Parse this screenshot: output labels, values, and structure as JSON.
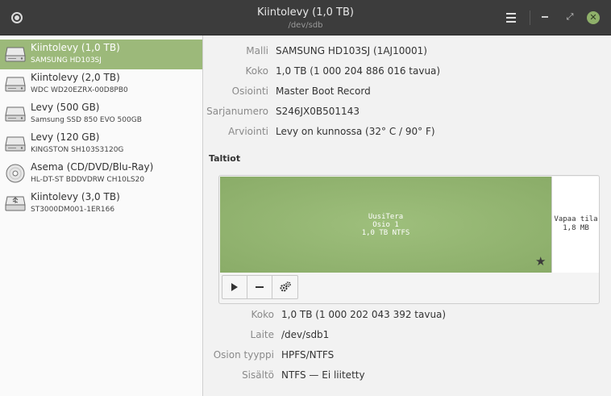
{
  "window": {
    "title": "Kiintolevy (1,0 TB)",
    "subtitle": "/dev/sdb"
  },
  "disks": [
    {
      "name": "Kiintolevy (1,0 TB)",
      "model": "SAMSUNG HD103SJ",
      "icon": "harddisk-icon",
      "selected": true
    },
    {
      "name": "Kiintolevy (2,0 TB)",
      "model": "WDC WD20EZRX-00D8PB0",
      "icon": "harddisk-icon",
      "selected": false
    },
    {
      "name": "Levy (500 GB)",
      "model": "Samsung SSD 850 EVO 500GB",
      "icon": "harddisk-icon",
      "selected": false
    },
    {
      "name": "Levy (120 GB)",
      "model": "KINGSTON SH103S3120G",
      "icon": "harddisk-icon",
      "selected": false
    },
    {
      "name": "Asema (CD/DVD/Blu-Ray)",
      "model": "HL-DT-ST BDDVDRW CH10LS20",
      "icon": "optical-disc-icon",
      "selected": false
    },
    {
      "name": "Kiintolevy (3,0 TB)",
      "model": "ST3000DM001-1ER166",
      "icon": "usb-drive-icon",
      "selected": false
    }
  ],
  "drive_props": [
    {
      "label": "Malli",
      "value": "SAMSUNG HD103SJ (1AJ10001)"
    },
    {
      "label": "Koko",
      "value": "1,0 TB (1 000 204 886 016 tavua)"
    },
    {
      "label": "Osiointi",
      "value": "Master Boot Record"
    },
    {
      "label": "Sarjanumero",
      "value": "S246JX0B501143"
    },
    {
      "label": "Arviointi",
      "value": "Levy on kunnossa (32° C / 90° F)"
    }
  ],
  "volumes": {
    "title": "Taltiot",
    "partition": {
      "name": "UusiTera",
      "number": "Osio 1",
      "desc": "1,0 TB NTFS"
    },
    "free": {
      "label": "Vapaa tila",
      "size": "1,8 MB"
    }
  },
  "partition_props": [
    {
      "label": "Koko",
      "value": "1,0 TB (1 000 202 043 392 tavua)"
    },
    {
      "label": "Laite",
      "value": "/dev/sdb1"
    },
    {
      "label": "Osion tyyppi",
      "value": "HPFS/NTFS"
    },
    {
      "label": "Sisältö",
      "value": "NTFS — Ei liitetty"
    }
  ],
  "colors": {
    "accent": "#9cb97a",
    "header": "#3c3c3c",
    "close_button": "#8fb06a"
  }
}
